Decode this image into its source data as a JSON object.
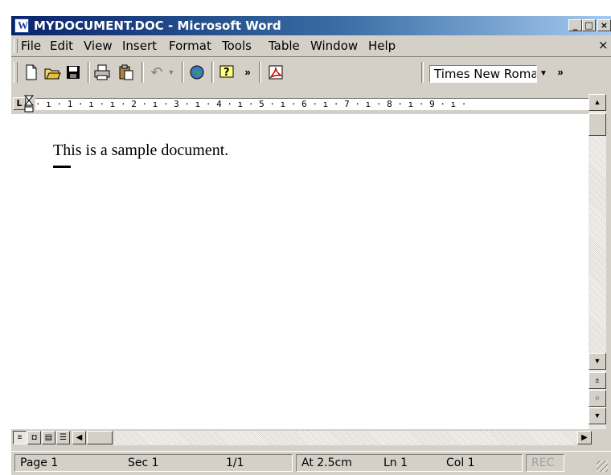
{
  "window": {
    "title": "MYDOCUMENT.DOC - Microsoft Word",
    "buttons": {
      "minimize": "_",
      "maximize": "□",
      "close": "×"
    }
  },
  "menubar": {
    "items": [
      "File",
      "Edit",
      "View",
      "Insert",
      "Format",
      "Tools",
      "Table",
      "Window",
      "Help"
    ],
    "close": "×"
  },
  "toolbar": {
    "buttons": [
      "new-icon",
      "open-icon",
      "save-icon",
      "print-icon",
      "paste-icon",
      "undo-icon",
      "web-icon",
      "help-icon",
      "more-icon",
      "pdf-icon"
    ],
    "font_name": "Times New Roman"
  },
  "ruler": {
    "scale": "·  ı  ·  1  ·  ı  ·  ı  ·  2  ·  ı  ·  3  ·  ı  ·  4  ·  ı  ·  5  ·  ı  ·  6  ·  ı  ·  7  ·  ı  ·  8  ·  ı  ·  9  ·  ı  ·"
  },
  "document": {
    "text": "This is a sample document."
  },
  "statusbar": {
    "page": "Page 1",
    "section": "Sec 1",
    "page_count": "1/1",
    "at": "At 2.5cm",
    "line": "Ln 1",
    "col": "Col 1",
    "rec": "REC"
  }
}
